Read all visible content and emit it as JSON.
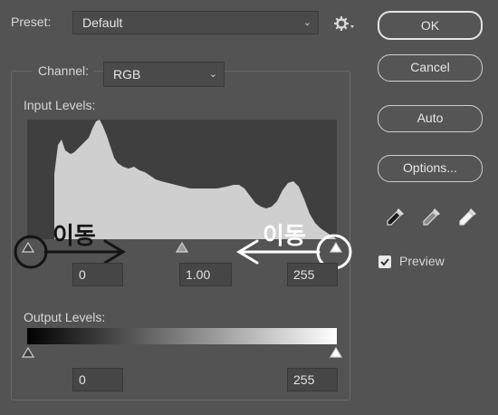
{
  "preset": {
    "label": "Preset:",
    "value": "Default"
  },
  "channel": {
    "label": "Channel:",
    "value": "RGB"
  },
  "input_levels": {
    "label": "Input Levels:",
    "black_point": "0",
    "midtone": "1.00",
    "white_point": "255"
  },
  "output_levels": {
    "label": "Output Levels:",
    "black_point": "0",
    "white_point": "255"
  },
  "buttons": {
    "ok": "OK",
    "cancel": "Cancel",
    "auto": "Auto",
    "options": "Options..."
  },
  "preview": {
    "label": "Preview",
    "checked": true
  },
  "annotations": {
    "left_move_label": "이동",
    "right_move_label": "이동"
  },
  "icons": {
    "settings": "gear-icon",
    "eyedroppers": [
      "black-eyedropper-icon",
      "gray-eyedropper-icon",
      "white-eyedropper-icon"
    ]
  }
}
